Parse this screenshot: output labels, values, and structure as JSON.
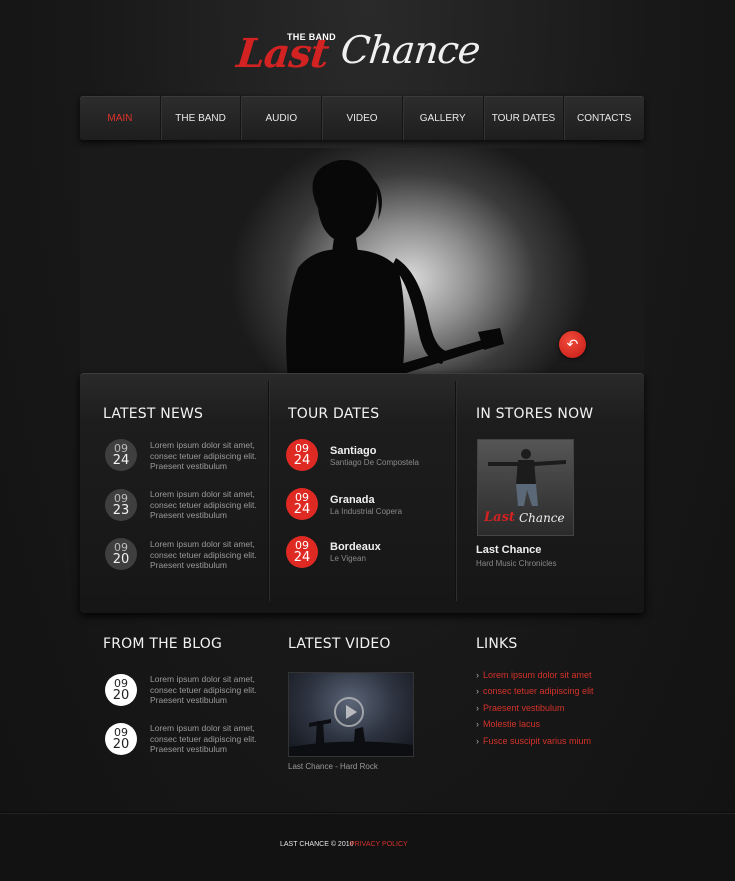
{
  "logo": {
    "small": "THE BAND",
    "word1": "Last",
    "word2": "Chance"
  },
  "nav": {
    "items": [
      {
        "label": "MAIN"
      },
      {
        "label": "THE BAND"
      },
      {
        "label": "AUDIO"
      },
      {
        "label": "VIDEO"
      },
      {
        "label": "GALLERY"
      },
      {
        "label": "TOUR DATES"
      },
      {
        "label": "CONTACTS"
      }
    ],
    "active": "MAIN"
  },
  "hero": {
    "button_icon": "undo-arrow-icon"
  },
  "latest_news": {
    "title": "LATEST NEWS",
    "items": [
      {
        "month": "09",
        "day": "24",
        "text": "Lorem ipsum dolor sit amet, consec tetuer adipiscing elit. Praesent vestibulum"
      },
      {
        "month": "09",
        "day": "23",
        "text": "Lorem ipsum dolor sit amet, consec tetuer adipiscing elit. Praesent vestibulum"
      },
      {
        "month": "09",
        "day": "20",
        "text": "Lorem ipsum dolor sit amet, consec tetuer adipiscing elit. Praesent vestibulum"
      }
    ]
  },
  "tour_dates": {
    "title": "TOUR DATES",
    "items": [
      {
        "month": "09",
        "day": "24",
        "city": "Santiago",
        "venue": "Santiago De Compostela"
      },
      {
        "month": "09",
        "day": "24",
        "city": "Granada",
        "venue": "La Industrial Copera"
      },
      {
        "month": "09",
        "day": "24",
        "city": "Bordeaux",
        "venue": "Le Vigean"
      }
    ]
  },
  "in_stores": {
    "title": "IN STORES NOW",
    "album_logo1": "Last",
    "album_logo2": "Chance",
    "album_title": "Last Chance",
    "album_subtitle": "Hard Music Chronicles"
  },
  "blog": {
    "title": "FROM THE BLOG",
    "items": [
      {
        "month": "09",
        "day": "20",
        "text": "Lorem ipsum dolor sit amet, consec tetuer adipiscing elit. Praesent vestibulum"
      },
      {
        "month": "09",
        "day": "20",
        "text": "Lorem ipsum dolor sit amet, consec tetuer adipiscing elit. Praesent vestibulum"
      }
    ]
  },
  "latest_video": {
    "title": "LATEST VIDEO",
    "caption": "Last Chance - Hard Rock"
  },
  "links": {
    "title": "LINKS",
    "items": [
      "Lorem ipsum dolor sit amet",
      "consec tetuer adipiscing elit",
      "Praesent vestibulum",
      "Molestie lacus",
      "Fusce suscipit varius mium"
    ]
  },
  "footer": {
    "copyright": "LAST CHANCE © 2010",
    "privacy": "PRIVACY POLICY"
  },
  "colors": {
    "accent": "#df2a24",
    "background": "#1a1a1a"
  }
}
